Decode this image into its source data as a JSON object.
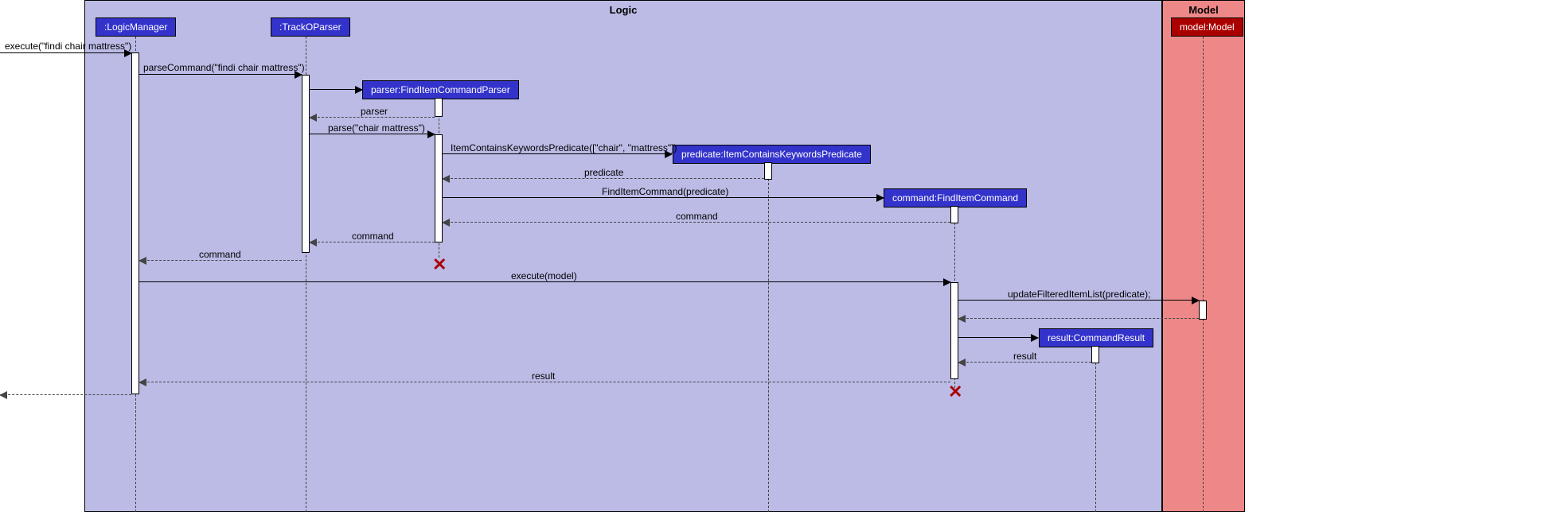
{
  "boxes": {
    "logic": "Logic",
    "model": "Model"
  },
  "participants": {
    "logicManager": ":LogicManager",
    "trackOParser": ":TrackOParser",
    "findItemCommandParser": "parser:FindItemCommandParser",
    "predicate": "predicate:ItemContainsKeywordsPredicate",
    "findItemCommand": "command:FindItemCommand",
    "commandResult": "result:CommandResult",
    "model": "model:Model"
  },
  "messages": {
    "execute1": "execute(\"findi chair mattress\")",
    "parseCommand": "parseCommand(\"findi chair mattress\")",
    "parserReturn": "parser",
    "parse": "parse(\"chair mattress\")",
    "predicateNew": "ItemContainsKeywordsPredicate([\"chair\", \"mattress\"])",
    "predicateReturn": "predicate",
    "commandNew": "FindItemCommand(predicate)",
    "commandReturn1": "command",
    "commandReturn2": "command",
    "commandReturn3": "command",
    "executeModel": "execute(model)",
    "updateFiltered": "updateFilteredItemList(predicate);",
    "resultReturn1": "result",
    "resultReturn2": "result"
  }
}
